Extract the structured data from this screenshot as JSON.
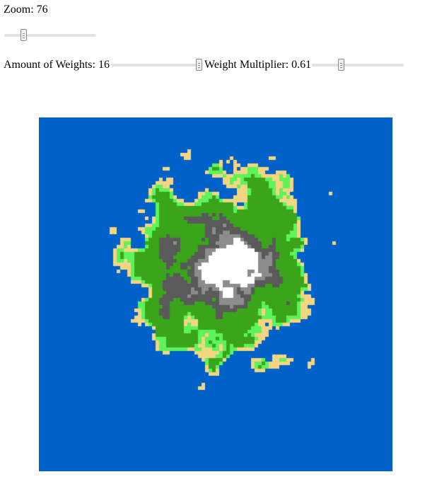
{
  "zoom": {
    "label": "Zoom: 76",
    "value": 76,
    "min": 0,
    "max": 400
  },
  "weights": {
    "label": "Amount of Weights: 16",
    "value": 16,
    "min": 0,
    "max": 16
  },
  "multiplier": {
    "label": "Weight Multiplier: 0.61",
    "value": 0.61,
    "min": 0,
    "max": 2
  },
  "map": {
    "colors": {
      "deep_water": "#0062c8",
      "sand": "#f4d582",
      "light_grass": "#5cf45a",
      "grass": "#3aa41b",
      "rock": "#5a5a5a",
      "high_rock": "#8c8c8c",
      "snow": "#ffffff"
    }
  }
}
